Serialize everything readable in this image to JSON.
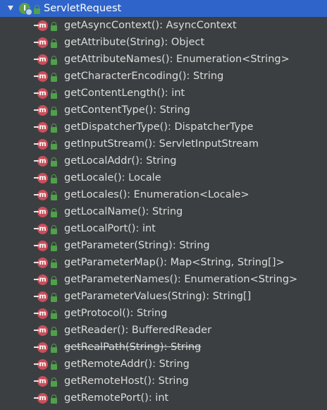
{
  "tree": {
    "root": {
      "label": "ServletRequest",
      "icon": "interface-icon",
      "expanded": true,
      "selected": true,
      "selection_color": "#2f65ca"
    },
    "methods": [
      {
        "label": "getAsyncContext(): AsyncContext",
        "deprecated": false
      },
      {
        "label": "getAttribute(String): Object",
        "deprecated": false
      },
      {
        "label": "getAttributeNames(): Enumeration<String>",
        "deprecated": false
      },
      {
        "label": "getCharacterEncoding(): String",
        "deprecated": false
      },
      {
        "label": "getContentLength(): int",
        "deprecated": false
      },
      {
        "label": "getContentType(): String",
        "deprecated": false
      },
      {
        "label": "getDispatcherType(): DispatcherType",
        "deprecated": false
      },
      {
        "label": "getInputStream(): ServletInputStream",
        "deprecated": false
      },
      {
        "label": "getLocalAddr(): String",
        "deprecated": false
      },
      {
        "label": "getLocale(): Locale",
        "deprecated": false
      },
      {
        "label": "getLocales(): Enumeration<Locale>",
        "deprecated": false
      },
      {
        "label": "getLocalName(): String",
        "deprecated": false
      },
      {
        "label": "getLocalPort(): int",
        "deprecated": false
      },
      {
        "label": "getParameter(String): String",
        "deprecated": false
      },
      {
        "label": "getParameterMap(): Map<String, String[]>",
        "deprecated": false
      },
      {
        "label": "getParameterNames(): Enumeration<String>",
        "deprecated": false
      },
      {
        "label": "getParameterValues(String): String[]",
        "deprecated": false
      },
      {
        "label": "getProtocol(): String",
        "deprecated": false
      },
      {
        "label": "getReader(): BufferedReader",
        "deprecated": false
      },
      {
        "label": "getRealPath(String): String",
        "deprecated": true
      },
      {
        "label": "getRemoteAddr(): String",
        "deprecated": false
      },
      {
        "label": "getRemoteHost(): String",
        "deprecated": false
      },
      {
        "label": "getRemotePort(): int",
        "deprecated": false
      }
    ],
    "colors": {
      "background": "#3c3f41",
      "text": "#dcdcdc",
      "method_icon": "#c94f5a",
      "lock_icon": "#4fa14a",
      "interface_icon": "#5e9f47"
    }
  }
}
